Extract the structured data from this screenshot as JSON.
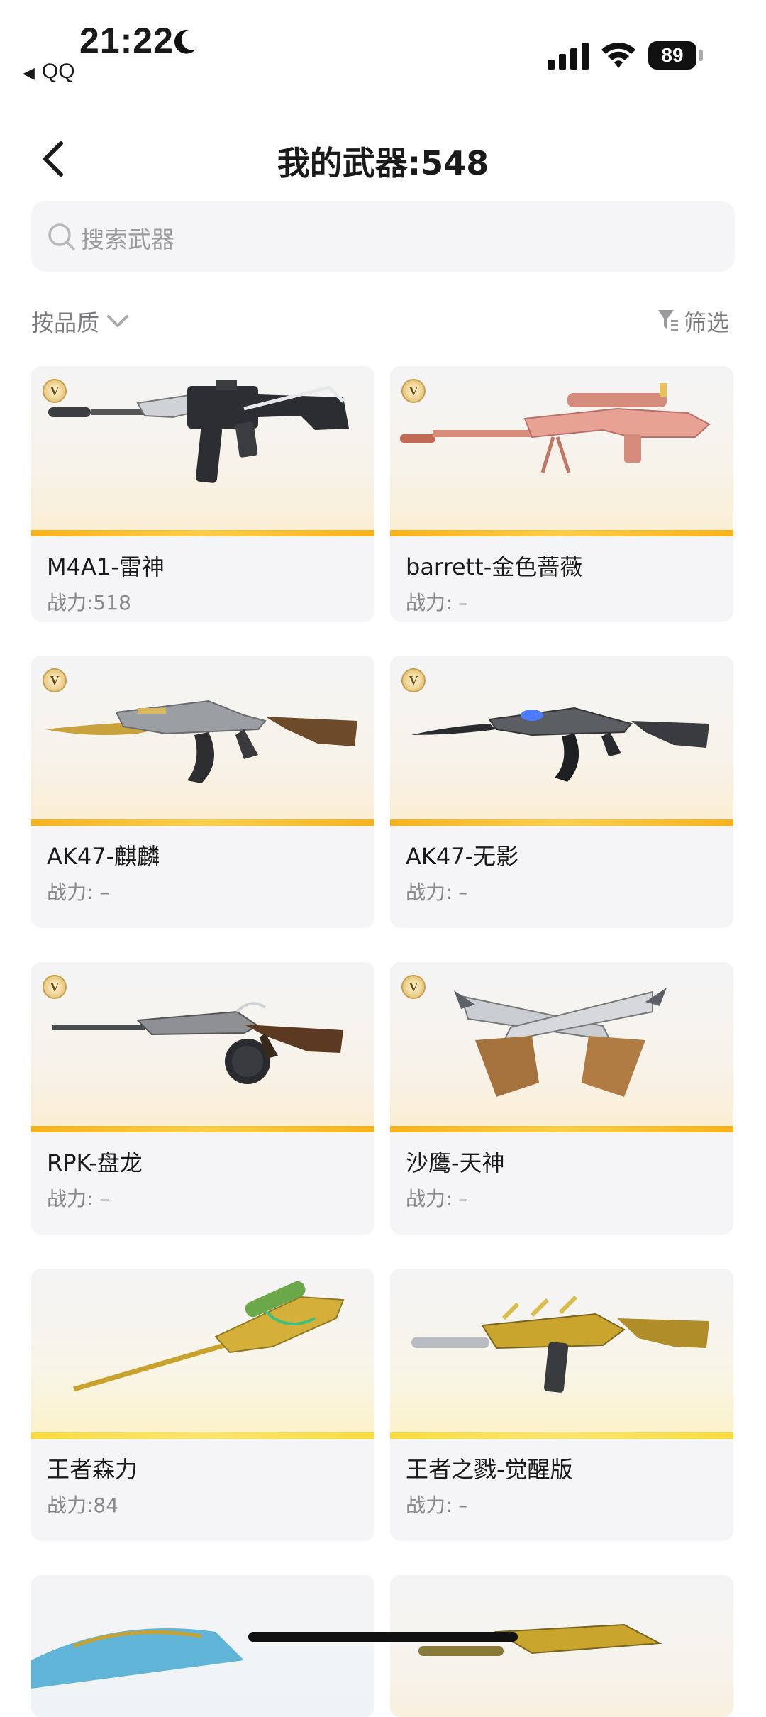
{
  "status_bar": {
    "time": "21:22",
    "back_app": "QQ",
    "battery": "89"
  },
  "nav": {
    "title": "我的武器:548"
  },
  "search": {
    "placeholder": "搜索武器"
  },
  "filters": {
    "sort_label": "按品质",
    "filter_label": "筛选"
  },
  "badge_letter": "V",
  "weapons": [
    {
      "name": "M4A1-雷神",
      "power": "战力:518"
    },
    {
      "name": "barrett-金色蔷薇",
      "power": "战力: –"
    },
    {
      "name": "AK47-麒麟",
      "power": "战力: –"
    },
    {
      "name": "AK47-无影",
      "power": "战力: –"
    },
    {
      "name": "RPK-盘龙",
      "power": "战力: –"
    },
    {
      "name": "沙鹰-天神",
      "power": "战力: –"
    },
    {
      "name": "王者森力",
      "power": "战力:84"
    },
    {
      "name": "王者之戮-觉醒版",
      "power": "战力: –"
    }
  ]
}
